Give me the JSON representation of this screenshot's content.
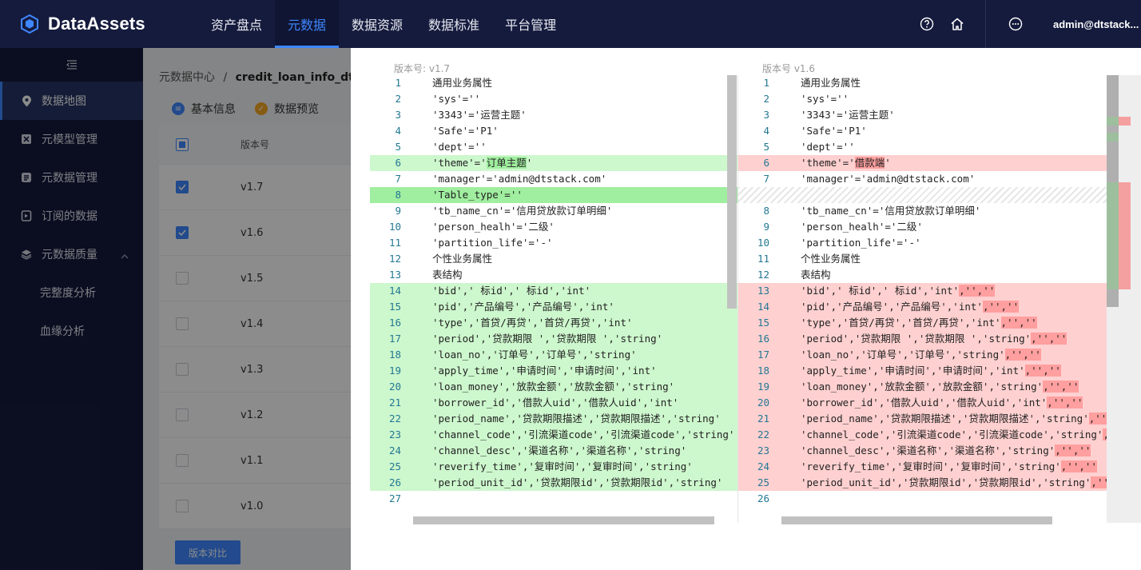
{
  "brand": {
    "title": "DataAssets"
  },
  "nav": [
    "资产盘点",
    "元数据",
    "数据资源",
    "数据标准",
    "平台管理"
  ],
  "nav_active": 1,
  "user": {
    "name": "admin@dtstack..."
  },
  "sidebar": {
    "items": [
      {
        "label": "数据地图",
        "icon": "location-icon",
        "active": true
      },
      {
        "label": "元模型管理",
        "icon": "model-icon"
      },
      {
        "label": "元数据管理",
        "icon": "database-icon"
      },
      {
        "label": "订阅的数据",
        "icon": "subscribe-icon"
      },
      {
        "label": "元数据质量",
        "icon": "quality-icon",
        "expanded": true
      }
    ],
    "subitems": [
      "完整度分析",
      "血缘分析"
    ]
  },
  "main": {
    "breadcrumb_root": "元数据中心",
    "breadcrumb_sep": "/",
    "breadcrumb_current": "credit_loan_info_dtl_df",
    "tabs": [
      "基本信息",
      "数据预览"
    ],
    "table_header": "版本号",
    "versions": [
      {
        "label": "v1.7",
        "checked": true
      },
      {
        "label": "v1.6",
        "checked": true
      },
      {
        "label": "v1.5",
        "checked": false
      },
      {
        "label": "v1.4",
        "checked": false
      },
      {
        "label": "v1.3",
        "checked": false
      },
      {
        "label": "v1.2",
        "checked": false
      },
      {
        "label": "v1.1",
        "checked": false
      },
      {
        "label": "v1.0",
        "checked": false
      }
    ],
    "compare_button": "版本对比"
  },
  "diff": {
    "left_title": "版本号: v1.7",
    "right_title": "版本号 v1.6",
    "colors": {
      "insert": "#cdf7cd",
      "insert_strong": "#a0ee9f",
      "delete": "#ffd0d0",
      "delete_strong": "#ff9f9f"
    },
    "left": [
      {
        "n": "1",
        "t": "通用业务属性"
      },
      {
        "n": "2",
        "t": "'sys'=''"
      },
      {
        "n": "3",
        "t": "'3343'='运营主题'"
      },
      {
        "n": "4",
        "t": "'Safe'='P1'"
      },
      {
        "n": "5",
        "t": "'dept'=''"
      },
      {
        "n": "6",
        "t": "'theme'='",
        "h": "订单主题",
        "r": "'",
        "c": "ins"
      },
      {
        "n": "7",
        "t": "'manager'='admin@dtstack.com'"
      },
      {
        "n": "8",
        "t": "'Table_type'=''",
        "c": "ins-strong"
      },
      {
        "n": "9",
        "t": "'tb_name_cn'='信用贷放款订单明细'"
      },
      {
        "n": "10",
        "t": "'person_healh'='二级'"
      },
      {
        "n": "11",
        "t": "'partition_life'='-'"
      },
      {
        "n": "12",
        "t": "个性业务属性"
      },
      {
        "n": "13",
        "t": "表结构"
      },
      {
        "n": "14",
        "t": "'bid',' 标id',' 标id','int'",
        "c": "ins"
      },
      {
        "n": "15",
        "t": "'pid','产品编号','产品编号','int'",
        "c": "ins"
      },
      {
        "n": "16",
        "t": "'type','首贷/再贷','首贷/再贷','int'",
        "c": "ins"
      },
      {
        "n": "17",
        "t": "'period','贷款期限 ','贷款期限 ','string'",
        "c": "ins"
      },
      {
        "n": "18",
        "t": "'loan_no','订单号','订单号','string'",
        "c": "ins"
      },
      {
        "n": "19",
        "t": "'apply_time','申请时间','申请时间','int'",
        "c": "ins"
      },
      {
        "n": "20",
        "t": "'loan_money','放款金额','放款金额','string'",
        "c": "ins"
      },
      {
        "n": "21",
        "t": "'borrower_id','借款人uid','借款人uid','int'",
        "c": "ins"
      },
      {
        "n": "22",
        "t": "'period_name','贷款期限描述','贷款期限描述','string'",
        "c": "ins"
      },
      {
        "n": "23",
        "t": "'channel_code','引流渠道code','引流渠道code','string'",
        "c": "ins"
      },
      {
        "n": "24",
        "t": "'channel_desc','渠道名称','渠道名称','string'",
        "c": "ins"
      },
      {
        "n": "25",
        "t": "'reverify_time','复审时间','复审时间','string'",
        "c": "ins"
      },
      {
        "n": "26",
        "t": "'period_unit_id','贷款期限id','贷款期限id','string'",
        "c": "ins"
      },
      {
        "n": "27",
        "t": ""
      }
    ],
    "right": [
      {
        "n": "1",
        "t": "通用业务属性"
      },
      {
        "n": "2",
        "t": "'sys'=''"
      },
      {
        "n": "3",
        "t": "'3343'='运营主题'"
      },
      {
        "n": "4",
        "t": "'Safe'='P1'"
      },
      {
        "n": "5",
        "t": "'dept'=''"
      },
      {
        "n": "6",
        "t": "'theme'='",
        "h": "借款端",
        "r": "'",
        "c": "del"
      },
      {
        "n": "7",
        "t": "'manager'='admin@dtstack.com'"
      },
      {
        "n": "",
        "t": "",
        "c": "hatch"
      },
      {
        "n": "8",
        "t": "'tb_name_cn'='信用贷放款订单明细'"
      },
      {
        "n": "9",
        "t": "'person_healh'='二级'"
      },
      {
        "n": "10",
        "t": "'partition_life'='-'"
      },
      {
        "n": "11",
        "t": "个性业务属性"
      },
      {
        "n": "12",
        "t": "表结构"
      },
      {
        "n": "13",
        "t": "'bid',' 标id',' 标id','int'",
        "h": ",'',''",
        "c": "del"
      },
      {
        "n": "14",
        "t": "'pid','产品编号','产品编号','int'",
        "h": ",'',''",
        "c": "del"
      },
      {
        "n": "15",
        "t": "'type','首贷/再贷','首贷/再贷','int'",
        "h": ",'',''",
        "c": "del"
      },
      {
        "n": "16",
        "t": "'period','贷款期限 ','贷款期限 ','string'",
        "h": ",'',''",
        "c": "del"
      },
      {
        "n": "17",
        "t": "'loan_no','订单号','订单号','string'",
        "h": ",'',''",
        "c": "del"
      },
      {
        "n": "18",
        "t": "'apply_time','申请时间','申请时间','int'",
        "h": ",'',''",
        "c": "del"
      },
      {
        "n": "19",
        "t": "'loan_money','放款金额','放款金额','string'",
        "h": ",'',''",
        "c": "del"
      },
      {
        "n": "20",
        "t": "'borrower_id','借款人uid','借款人uid','int'",
        "h": ",'',''",
        "c": "del"
      },
      {
        "n": "21",
        "t": "'period_name','贷款期限描述','贷款期限描述','string'",
        "h": ",'',",
        "c": "del"
      },
      {
        "n": "22",
        "t": "'channel_code','引流渠道code','引流渠道code','string'",
        "h": ",",
        "c": "del"
      },
      {
        "n": "23",
        "t": "'channel_desc','渠道名称','渠道名称','string'",
        "h": ",'',''",
        "c": "del"
      },
      {
        "n": "24",
        "t": "'reverify_time','复审时间','复审时间','string'",
        "h": ",'',''",
        "c": "del"
      },
      {
        "n": "25",
        "t": "'period_unit_id','贷款期限id','贷款期限id','string'",
        "h": ",'',",
        "c": "del"
      },
      {
        "n": "26",
        "t": ""
      }
    ]
  }
}
